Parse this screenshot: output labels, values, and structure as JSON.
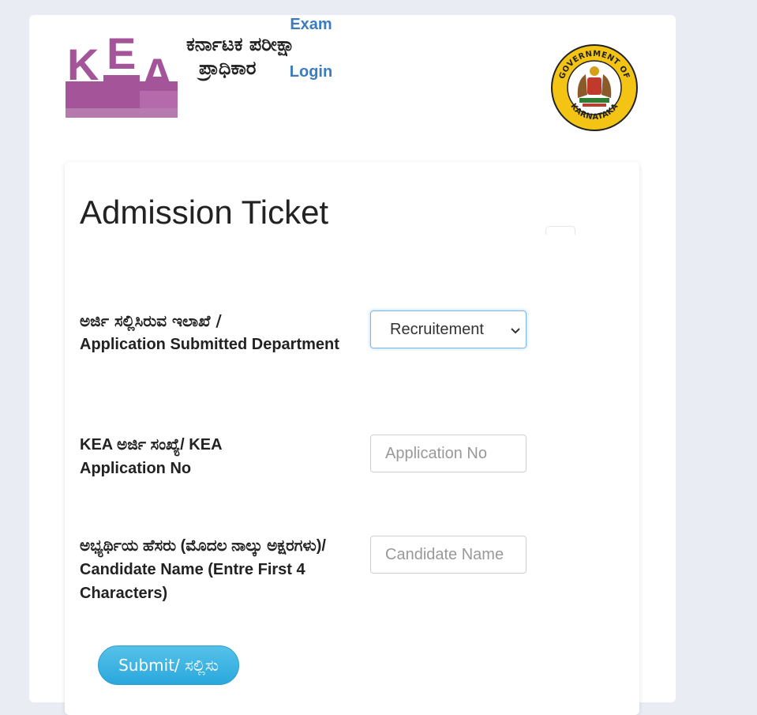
{
  "header": {
    "logo_letters": [
      "K",
      "E",
      "A"
    ],
    "title_line1": "ಕರ್ನಾಟಕ ಪರೀಕ್ಷಾ",
    "title_line2": "ಪ್ರಾಧಿಕಾರ",
    "exam_link_line1": "Exam",
    "exam_link_line2": "Login",
    "seal_top_text": "GOVERNMENT OF",
    "seal_bottom_text": "KARNATAKA"
  },
  "form": {
    "title": "Admission Ticket",
    "department": {
      "label_kn": "ಅರ್ಜಿ ಸಲ್ಲಿಸಿರುವ ಇಲಾಖೆ /",
      "label_en": "Application Submitted Department",
      "selected": "Recruitement"
    },
    "application_no": {
      "label_kn": "KEA ಅರ್ಜಿ ಸಂಖ್ಯೆ/ KEA",
      "label_en": "Application No",
      "placeholder": "Application No"
    },
    "candidate_name": {
      "label_kn": "ಅಭ್ಯರ್ಥಿಯ ಹೆಸರು (ಮೊದಲ ನಾಲ್ಕು ಅಕ್ಷರಗಳು)/",
      "label_en": "Candidate Name (Entre First 4 Characters)",
      "placeholder": "Candidate Name"
    },
    "submit_label": "Submit/ ಸಲ್ಲಿಸು"
  },
  "colors": {
    "logo_purple": "#a4559a",
    "link_blue": "#3a7dbf",
    "button_blue": "#36b0e0",
    "seal_yellow": "#f3c414"
  }
}
